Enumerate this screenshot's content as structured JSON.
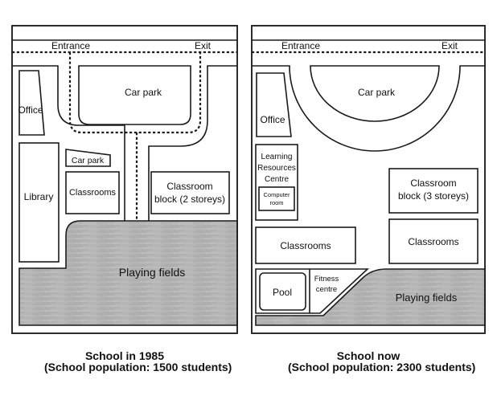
{
  "maps": [
    {
      "id": "1985",
      "caption_title": "School in 1985",
      "caption_population": "(School population: 1500 students)",
      "labels": {
        "entrance": "Entrance",
        "exit": "Exit",
        "car_park_main": "Car park",
        "office": "Office",
        "library": "Library",
        "car_park_small": "Car park",
        "classrooms": "Classrooms",
        "classroom_block_line1": "Classroom",
        "classroom_block_line2": "block (2 storeys)",
        "playing_fields": "Playing fields"
      }
    },
    {
      "id": "now",
      "caption_title": "School now",
      "caption_population": "(School population: 2300 students)",
      "labels": {
        "entrance": "Entrance",
        "exit": "Exit",
        "car_park_main": "Car park",
        "office": "Office",
        "lrc_line1": "Learning",
        "lrc_line2": "Resources",
        "lrc_line3": "Centre",
        "computer_room_line1": "Computer",
        "computer_room_line2": "room",
        "classrooms_left": "Classrooms",
        "classroom_block_line1": "Classroom",
        "classroom_block_line2": "block (3 storeys)",
        "classrooms_right": "Classrooms",
        "pool": "Pool",
        "fitness_line1": "Fitness",
        "fitness_line2": "centre",
        "playing_fields": "Playing fields"
      }
    }
  ],
  "colors": {
    "playing_fields_fill": "#b4b4b4",
    "line": "#1a1a1a"
  }
}
